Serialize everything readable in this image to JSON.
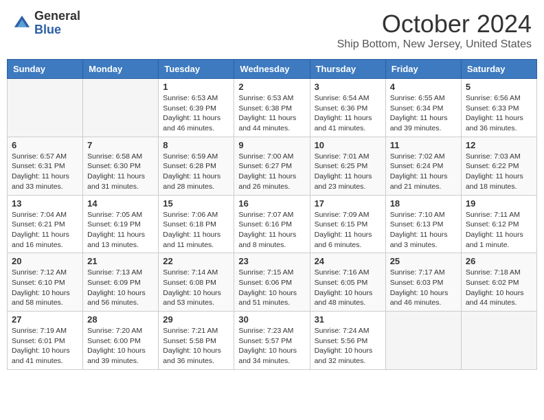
{
  "header": {
    "logo_general": "General",
    "logo_blue": "Blue",
    "month_title": "October 2024",
    "location": "Ship Bottom, New Jersey, United States"
  },
  "days_of_week": [
    "Sunday",
    "Monday",
    "Tuesday",
    "Wednesday",
    "Thursday",
    "Friday",
    "Saturday"
  ],
  "weeks": [
    [
      {
        "day": "",
        "empty": true
      },
      {
        "day": "",
        "empty": true
      },
      {
        "day": "1",
        "sunrise": "6:53 AM",
        "sunset": "6:39 PM",
        "daylight": "11 hours and 46 minutes."
      },
      {
        "day": "2",
        "sunrise": "6:53 AM",
        "sunset": "6:38 PM",
        "daylight": "11 hours and 44 minutes."
      },
      {
        "day": "3",
        "sunrise": "6:54 AM",
        "sunset": "6:36 PM",
        "daylight": "11 hours and 41 minutes."
      },
      {
        "day": "4",
        "sunrise": "6:55 AM",
        "sunset": "6:34 PM",
        "daylight": "11 hours and 39 minutes."
      },
      {
        "day": "5",
        "sunrise": "6:56 AM",
        "sunset": "6:33 PM",
        "daylight": "11 hours and 36 minutes."
      }
    ],
    [
      {
        "day": "6",
        "sunrise": "6:57 AM",
        "sunset": "6:31 PM",
        "daylight": "11 hours and 33 minutes."
      },
      {
        "day": "7",
        "sunrise": "6:58 AM",
        "sunset": "6:30 PM",
        "daylight": "11 hours and 31 minutes."
      },
      {
        "day": "8",
        "sunrise": "6:59 AM",
        "sunset": "6:28 PM",
        "daylight": "11 hours and 28 minutes."
      },
      {
        "day": "9",
        "sunrise": "7:00 AM",
        "sunset": "6:27 PM",
        "daylight": "11 hours and 26 minutes."
      },
      {
        "day": "10",
        "sunrise": "7:01 AM",
        "sunset": "6:25 PM",
        "daylight": "11 hours and 23 minutes."
      },
      {
        "day": "11",
        "sunrise": "7:02 AM",
        "sunset": "6:24 PM",
        "daylight": "11 hours and 21 minutes."
      },
      {
        "day": "12",
        "sunrise": "7:03 AM",
        "sunset": "6:22 PM",
        "daylight": "11 hours and 18 minutes."
      }
    ],
    [
      {
        "day": "13",
        "sunrise": "7:04 AM",
        "sunset": "6:21 PM",
        "daylight": "11 hours and 16 minutes."
      },
      {
        "day": "14",
        "sunrise": "7:05 AM",
        "sunset": "6:19 PM",
        "daylight": "11 hours and 13 minutes."
      },
      {
        "day": "15",
        "sunrise": "7:06 AM",
        "sunset": "6:18 PM",
        "daylight": "11 hours and 11 minutes."
      },
      {
        "day": "16",
        "sunrise": "7:07 AM",
        "sunset": "6:16 PM",
        "daylight": "11 hours and 8 minutes."
      },
      {
        "day": "17",
        "sunrise": "7:09 AM",
        "sunset": "6:15 PM",
        "daylight": "11 hours and 6 minutes."
      },
      {
        "day": "18",
        "sunrise": "7:10 AM",
        "sunset": "6:13 PM",
        "daylight": "11 hours and 3 minutes."
      },
      {
        "day": "19",
        "sunrise": "7:11 AM",
        "sunset": "6:12 PM",
        "daylight": "11 hours and 1 minute."
      }
    ],
    [
      {
        "day": "20",
        "sunrise": "7:12 AM",
        "sunset": "6:10 PM",
        "daylight": "10 hours and 58 minutes."
      },
      {
        "day": "21",
        "sunrise": "7:13 AM",
        "sunset": "6:09 PM",
        "daylight": "10 hours and 56 minutes."
      },
      {
        "day": "22",
        "sunrise": "7:14 AM",
        "sunset": "6:08 PM",
        "daylight": "10 hours and 53 minutes."
      },
      {
        "day": "23",
        "sunrise": "7:15 AM",
        "sunset": "6:06 PM",
        "daylight": "10 hours and 51 minutes."
      },
      {
        "day": "24",
        "sunrise": "7:16 AM",
        "sunset": "6:05 PM",
        "daylight": "10 hours and 48 minutes."
      },
      {
        "day": "25",
        "sunrise": "7:17 AM",
        "sunset": "6:03 PM",
        "daylight": "10 hours and 46 minutes."
      },
      {
        "day": "26",
        "sunrise": "7:18 AM",
        "sunset": "6:02 PM",
        "daylight": "10 hours and 44 minutes."
      }
    ],
    [
      {
        "day": "27",
        "sunrise": "7:19 AM",
        "sunset": "6:01 PM",
        "daylight": "10 hours and 41 minutes."
      },
      {
        "day": "28",
        "sunrise": "7:20 AM",
        "sunset": "6:00 PM",
        "daylight": "10 hours and 39 minutes."
      },
      {
        "day": "29",
        "sunrise": "7:21 AM",
        "sunset": "5:58 PM",
        "daylight": "10 hours and 36 minutes."
      },
      {
        "day": "30",
        "sunrise": "7:23 AM",
        "sunset": "5:57 PM",
        "daylight": "10 hours and 34 minutes."
      },
      {
        "day": "31",
        "sunrise": "7:24 AM",
        "sunset": "5:56 PM",
        "daylight": "10 hours and 32 minutes."
      },
      {
        "day": "",
        "empty": true
      },
      {
        "day": "",
        "empty": true
      }
    ]
  ]
}
